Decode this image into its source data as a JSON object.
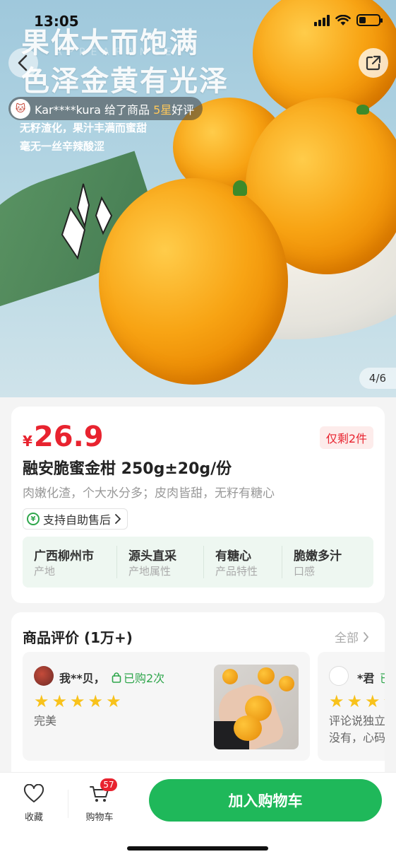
{
  "status": {
    "time": "13:05"
  },
  "hero": {
    "title_line1": "果体大而饱满",
    "title_line2": "色泽金黄有光泽",
    "watermark": "APPEARANCE",
    "sub_line1": "无籽渣化，果汁丰满而蜜甜",
    "sub_line2": "毫无一丝辛辣酸涩",
    "page_indicator": "4/6"
  },
  "review_ticker": {
    "user": "Kar****kura",
    "text_before": " 给了商品 ",
    "stars": "5星",
    "text_after": "好评"
  },
  "product": {
    "currency": "¥",
    "price": "26.9",
    "stock_badge": "仅剩2件",
    "name": "融安脆蜜金柑 250g±20g/份",
    "description": "肉嫩化渣，个大水分多；皮肉皆甜，无籽有糖心",
    "service": "支持自助售后",
    "attributes": [
      {
        "value": "广西柳州市",
        "key": "产地"
      },
      {
        "value": "源头直采",
        "key": "产地属性"
      },
      {
        "value": "有糖心",
        "key": "产品特性"
      },
      {
        "value": "脆嫩多汁",
        "key": "口感"
      }
    ]
  },
  "reviews": {
    "title": "商品评价 (1万+)",
    "all_label": "全部",
    "items": [
      {
        "user": "我**贝，",
        "badge": "已购2次",
        "rating": 5,
        "text": "完美"
      },
      {
        "user": "*君",
        "badge": "已",
        "rating": 5,
        "text_line1": "评论说独立",
        "text_line2": "没有，心码"
      }
    ]
  },
  "bottom_bar": {
    "favorite_label": "收藏",
    "cart_label": "购物车",
    "cart_count": "57",
    "add_to_cart": "加入购物车"
  },
  "colors": {
    "price_red": "#e8232f",
    "brand_green": "#1fb85a",
    "star_yellow": "#f8c21b"
  },
  "icons": [
    "back-arrow-icon",
    "share-icon",
    "shield-yen-icon",
    "chevron-right-icon",
    "heart-icon",
    "cart-icon",
    "bag-icon",
    "star-icon",
    "signal-icon",
    "wifi-icon",
    "battery-icon"
  ]
}
